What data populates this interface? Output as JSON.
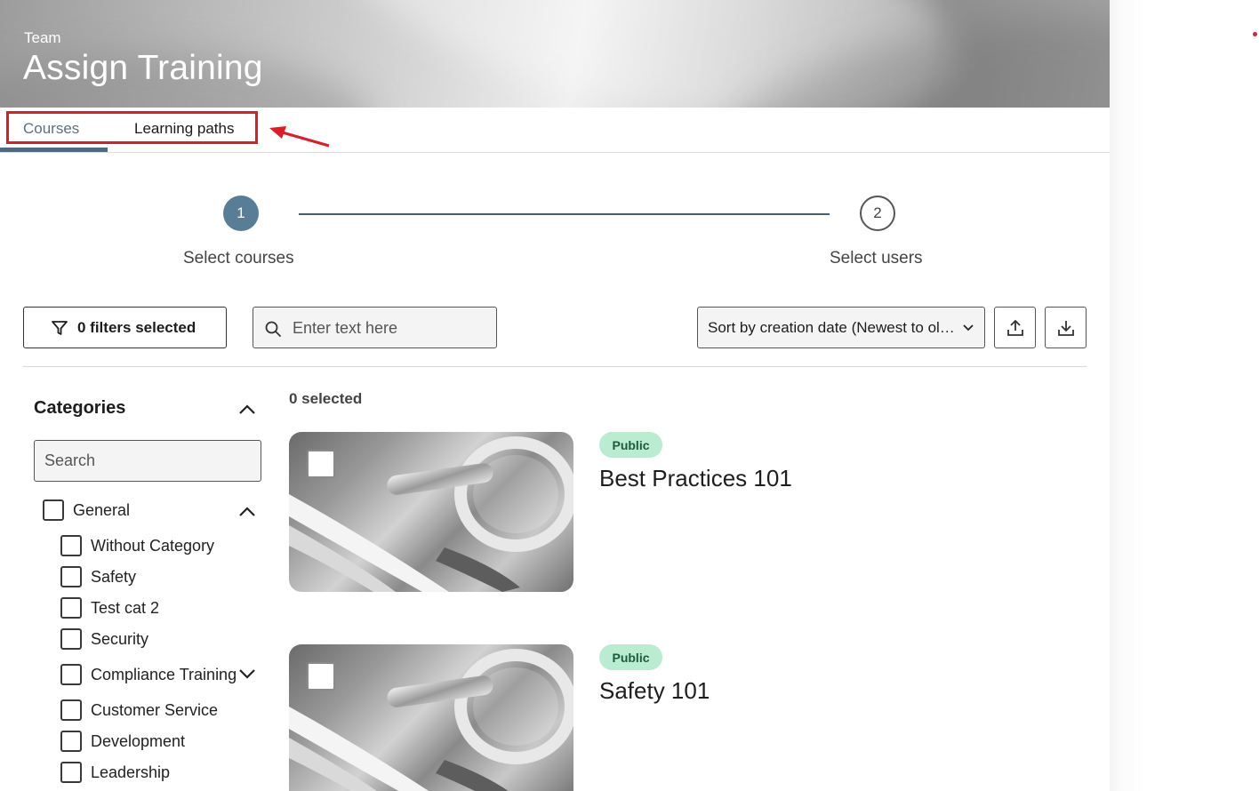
{
  "header": {
    "eyebrow": "Team",
    "title": "Assign Training"
  },
  "tabs": [
    {
      "label": "Courses",
      "active": true
    },
    {
      "label": "Learning paths",
      "active": false
    }
  ],
  "stepper": {
    "steps": [
      {
        "number": "1",
        "label": "Select courses",
        "active": true
      },
      {
        "number": "2",
        "label": "Select users",
        "active": false
      }
    ]
  },
  "toolbar": {
    "filters_label": "0 filters selected",
    "search_placeholder": "Enter text here",
    "sort_label": "Sort by creation date (Newest to oldest)",
    "upload_icon": "upload-icon",
    "download_icon": "download-icon"
  },
  "sidebar": {
    "title": "Categories",
    "search_placeholder": "Search",
    "groups": [
      {
        "label": "General",
        "children": [
          "Without Category",
          "Safety",
          "Test cat 2",
          "Security",
          "Compliance Training",
          "Customer Service",
          "Development",
          "Leadership"
        ]
      }
    ]
  },
  "list": {
    "selected_count": "0 selected",
    "courses": [
      {
        "badge": "Public",
        "title": "Best Practices 101"
      },
      {
        "badge": "Public",
        "title": "Safety 101"
      }
    ]
  },
  "colors": {
    "accent": "#587d97",
    "tab_underline": "#4d6a80",
    "badge_bg": "#b9ecd1",
    "annotation_red": "#e01b24"
  }
}
